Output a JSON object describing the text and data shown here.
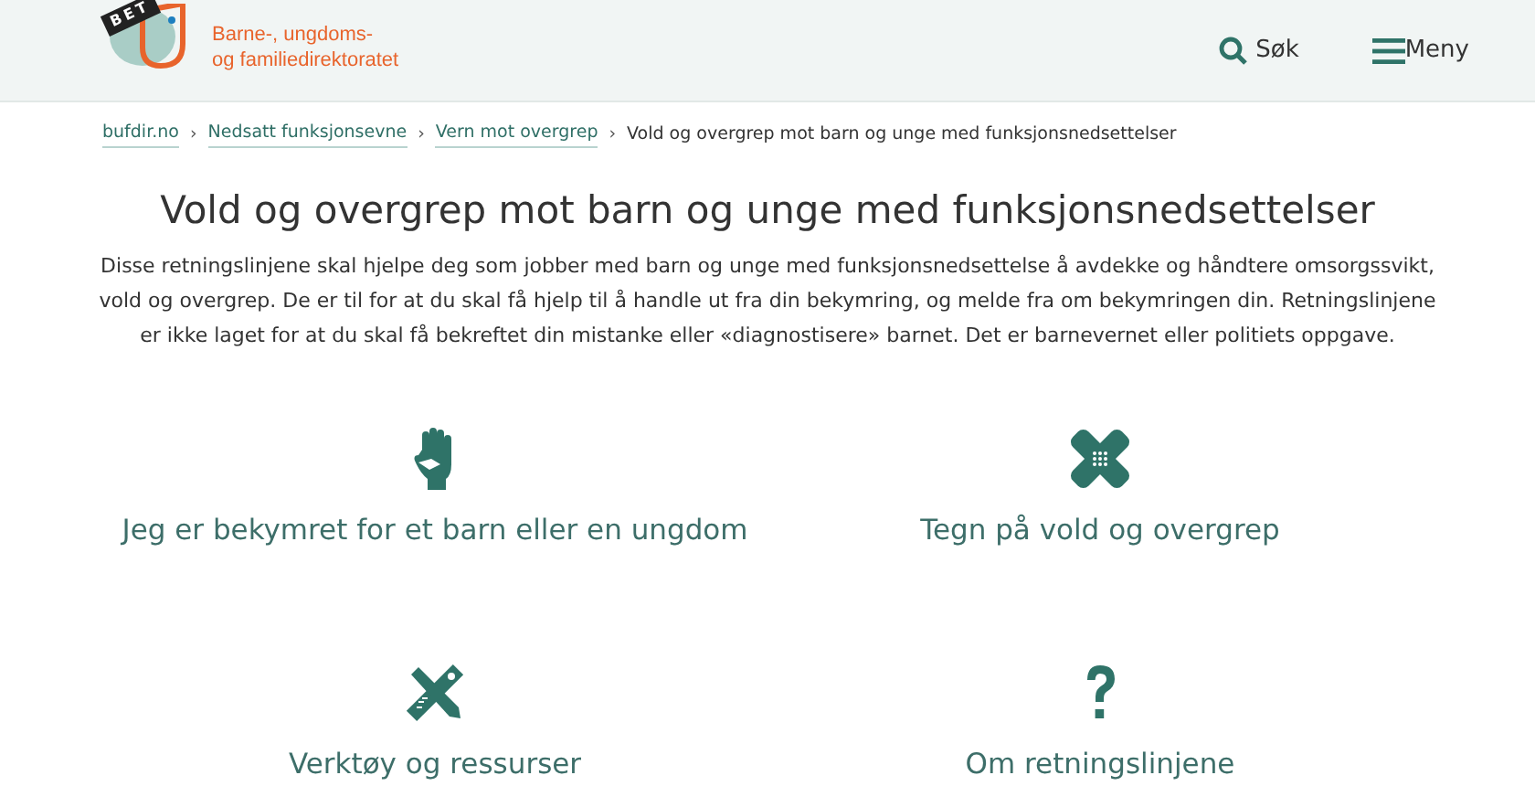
{
  "header": {
    "beta_badge": "BET",
    "logo_text": [
      "Barne-, ungdoms-",
      "og familiedirektoratet"
    ],
    "search": "Søk",
    "menu": "Meny"
  },
  "breadcrumb_separator": "›",
  "breadcrumb": [
    {
      "label": "bufdir.no",
      "kind": "link"
    },
    {
      "label": "Nedsatt funksjonsevne",
      "kind": "link"
    },
    {
      "label": "Vern mot overgrep",
      "kind": "link"
    },
    {
      "label": "Vold og overgrep mot barn og unge med funksjonsnedsettelser",
      "kind": "current"
    }
  ],
  "title": "Vold og overgrep mot barn og unge med funksjonsnedsettelser",
  "intro": "Disse retningslinjene skal hjelpe deg som jobber med barn og unge med funksjonsnedsettelse å avdekke og håndtere omsorgssvikt, vold og overgrep. De er til for at du skal få hjelp til å handle ut fra din bekymring, og melde fra om bekymringen din. Retningslinjene er ikke laget for at du skal få bekreftet din mistanke eller «diagnostisere» barnet. Det er barnevernet eller politiets oppgave.",
  "cards": [
    {
      "label": "Jeg er bekymret for et barn eller en ungdom",
      "kind": "hand"
    },
    {
      "label": "Tegn på vold og overgrep",
      "kind": "bandage"
    },
    {
      "label": "Verktøy og ressurser",
      "kind": "tools"
    },
    {
      "label": "Om retningslinjene",
      "kind": "question"
    }
  ]
}
